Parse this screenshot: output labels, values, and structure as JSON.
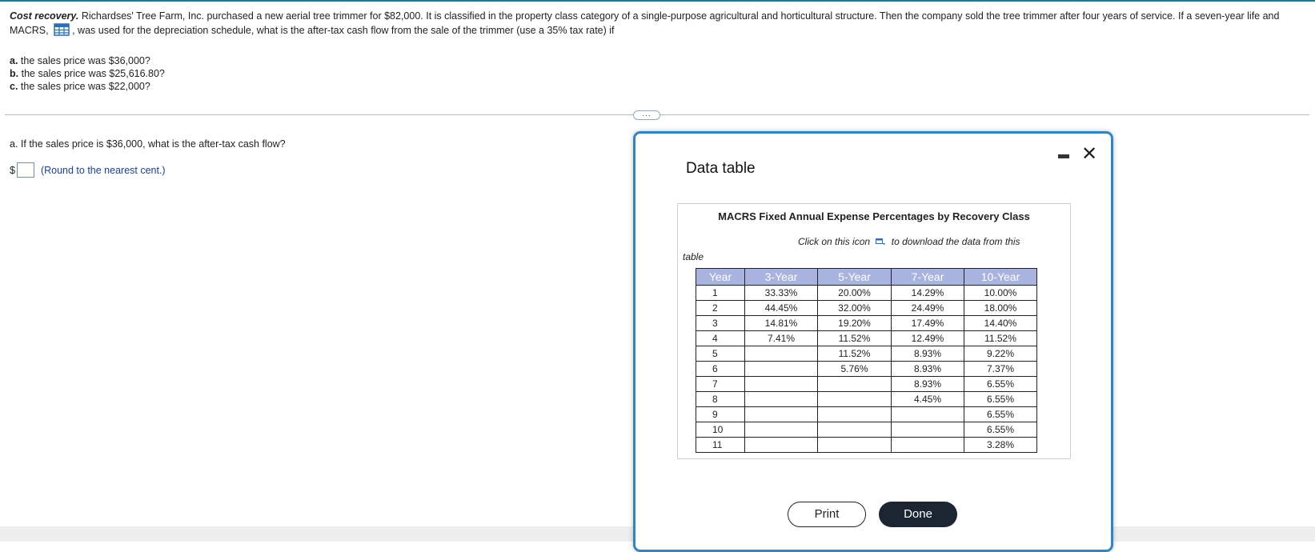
{
  "question": {
    "title": "Cost recovery.",
    "text_before_icon": "Richardses' Tree Farm, Inc. purchased a new aerial tree trimmer for $82,000.  It is classified in the property class category of a single-purpose agricultural and horticultural structure.  Then the company sold the tree trimmer after four years of service.  If a seven-year life and MACRS,",
    "text_after_icon": ", was used for the depreciation schedule, what is the after-tax cash flow from the sale of the trimmer (use a 35% tax rate) if",
    "icon": "table-grid-icon"
  },
  "parts": [
    {
      "label": "a.",
      "text": "the sales price was $36,000?"
    },
    {
      "label": "b.",
      "text": "the sales price was $25,616.80?"
    },
    {
      "label": "c.",
      "text": "the sales price was $22,000?"
    }
  ],
  "expand_button": "...",
  "answer": {
    "prompt": "a.  If the sales price is $36,000, what is the after-tax cash flow?",
    "currency": "$",
    "value": "",
    "hint": "(Round to the nearest cent.)"
  },
  "modal": {
    "title": "Data table",
    "minimize_icon": "minimize-icon",
    "close_icon": "close-icon",
    "close_glyph": "✕",
    "table_title": "MACRS Fixed Annual Expense Percentages by Recovery Class",
    "subtitle_before": "Click on this icon",
    "subtitle_after": "to download the data from this",
    "subtitle_wrap": "table",
    "columns": [
      "Year",
      "3-Year",
      "5-Year",
      "7-Year",
      "10-Year"
    ],
    "rows": [
      [
        "1",
        "33.33%",
        "20.00%",
        "14.29%",
        "10.00%"
      ],
      [
        "2",
        "44.45%",
        "32.00%",
        "24.49%",
        "18.00%"
      ],
      [
        "3",
        "14.81%",
        "19.20%",
        "17.49%",
        "14.40%"
      ],
      [
        "4",
        "7.41%",
        "11.52%",
        "12.49%",
        "11.52%"
      ],
      [
        "5",
        "",
        "11.52%",
        "8.93%",
        "9.22%"
      ],
      [
        "6",
        "",
        "5.76%",
        "8.93%",
        "7.37%"
      ],
      [
        "7",
        "",
        "",
        "8.93%",
        "6.55%"
      ],
      [
        "8",
        "",
        "",
        "4.45%",
        "6.55%"
      ],
      [
        "9",
        "",
        "",
        "",
        "6.55%"
      ],
      [
        "10",
        "",
        "",
        "",
        "6.55%"
      ],
      [
        "11",
        "",
        "",
        "",
        "3.28%"
      ]
    ],
    "print_label": "Print",
    "done_label": "Done"
  },
  "colors": {
    "accent": "#2f86c6",
    "table_header": "#a9b3df",
    "done_button": "#1c2633",
    "hint_text": "#1a3f9a"
  }
}
